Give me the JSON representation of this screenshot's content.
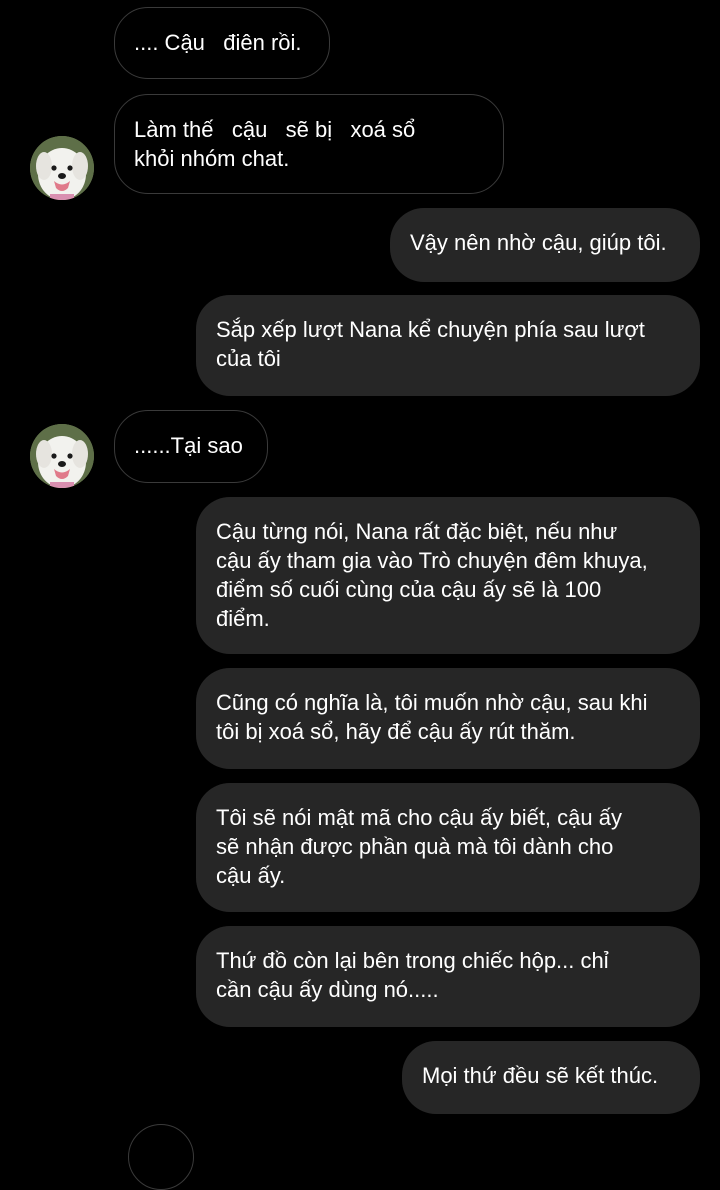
{
  "messages": [
    {
      "from": "them",
      "text": ".... Cậu   điên rồi."
    },
    {
      "from": "them",
      "text": "Làm thế   cậu   sẽ bị   xoá sổ\nkhỏi nhóm chat."
    },
    {
      "from": "me",
      "text": "Vậy nên nhờ cậu, giúp tôi."
    },
    {
      "from": "me",
      "text": "Sắp xếp lượt Nana kể chuyện phía sau lượt\ncủa tôi"
    },
    {
      "from": "them",
      "text": "......Tại sao"
    },
    {
      "from": "me",
      "text": "Cậu từng nói, Nana rất đặc biệt, nếu như\ncậu ấy tham gia vào Trò chuyện đêm khuya,\nđiểm số cuối cùng của cậu ấy sẽ là 100\nđiểm."
    },
    {
      "from": "me",
      "text": "Cũng có nghĩa là, tôi muốn nhờ cậu, sau khi\ntôi bị xoá sổ, hãy để cậu ấy rút thăm."
    },
    {
      "from": "me",
      "text": "Tôi sẽ nói mật mã cho cậu ấy biết, cậu ấy\nsẽ nhận được phần quà mà tôi dành cho\ncậu ấy."
    },
    {
      "from": "me",
      "text": "Thứ đồ còn lại bên trong chiếc hộp... chỉ\ncần cậu ấy dùng nó....."
    },
    {
      "from": "me",
      "text": "Mọi thứ đều sẽ kết thúc."
    }
  ],
  "contact": {
    "avatar_icon": "dog-avatar-icon"
  },
  "colors": {
    "background": "#000000",
    "outgoing_bubble": "#262626",
    "incoming_border": "#3a3a3a",
    "text": "#ffffff"
  }
}
